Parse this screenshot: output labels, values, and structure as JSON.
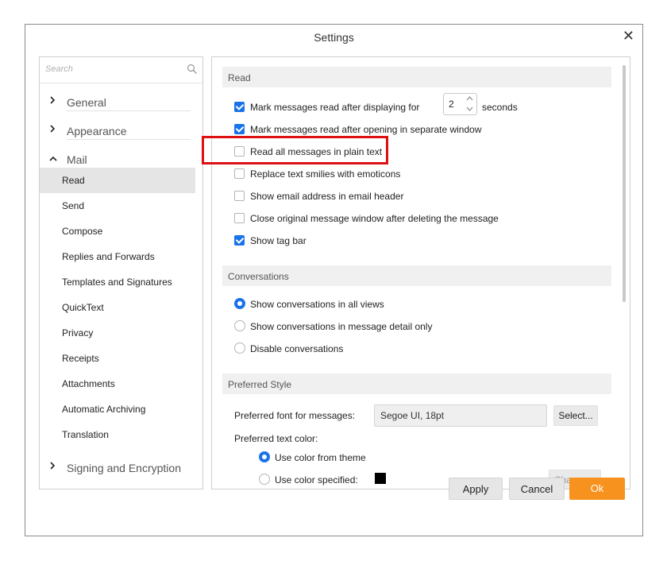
{
  "window": {
    "title": "Settings",
    "close_glyph": "✕"
  },
  "sidebar": {
    "search_placeholder": "Search",
    "sections": [
      {
        "chev": "›",
        "label": "General"
      },
      {
        "chev": "›",
        "label": "Appearance"
      },
      {
        "chev": "˄",
        "label": "Mail"
      },
      {
        "chev": "›",
        "label": "Signing and Encryption"
      }
    ],
    "mail_items": [
      "Read",
      "Send",
      "Compose",
      "Replies and Forwards",
      "Templates and Signatures",
      "QuickText",
      "Privacy",
      "Receipts",
      "Attachments",
      "Automatic Archiving",
      "Translation"
    ],
    "selected_item": "Read"
  },
  "read": {
    "header": "Read",
    "options": [
      {
        "label": "Mark messages read after displaying for",
        "checked": true
      },
      {
        "label": "Mark messages read after opening in separate window",
        "checked": true
      },
      {
        "label": "Read all messages in plain text",
        "checked": false
      },
      {
        "label": "Replace text smilies with emoticons",
        "checked": false
      },
      {
        "label": "Show email address in email header",
        "checked": false
      },
      {
        "label": "Close original message window after deleting the message",
        "checked": false
      },
      {
        "label": "Show tag bar",
        "checked": true
      }
    ],
    "seconds_value": "2",
    "seconds_unit": "seconds"
  },
  "conversations": {
    "header": "Conversations",
    "options": [
      {
        "label": "Show conversations in all views",
        "selected": true
      },
      {
        "label": "Show conversations in message detail only",
        "selected": false
      },
      {
        "label": "Disable conversations",
        "selected": false
      }
    ]
  },
  "preferred_style": {
    "header": "Preferred Style",
    "font_label": "Preferred font for messages:",
    "font_value": "Segoe UI, 18pt",
    "select_button": "Select...",
    "color_label": "Preferred text color:",
    "color_options": [
      {
        "label": "Use color from theme",
        "selected": true
      },
      {
        "label": "Use color specified:",
        "selected": false
      }
    ],
    "swatch_color": "#000000",
    "change_button": "Change..."
  },
  "footer": {
    "apply": "Apply",
    "cancel": "Cancel",
    "ok": "Ok"
  },
  "colors": {
    "accent": "#1a73e8",
    "ok_button": "#f7921e",
    "highlight_border": "#dd1111"
  }
}
